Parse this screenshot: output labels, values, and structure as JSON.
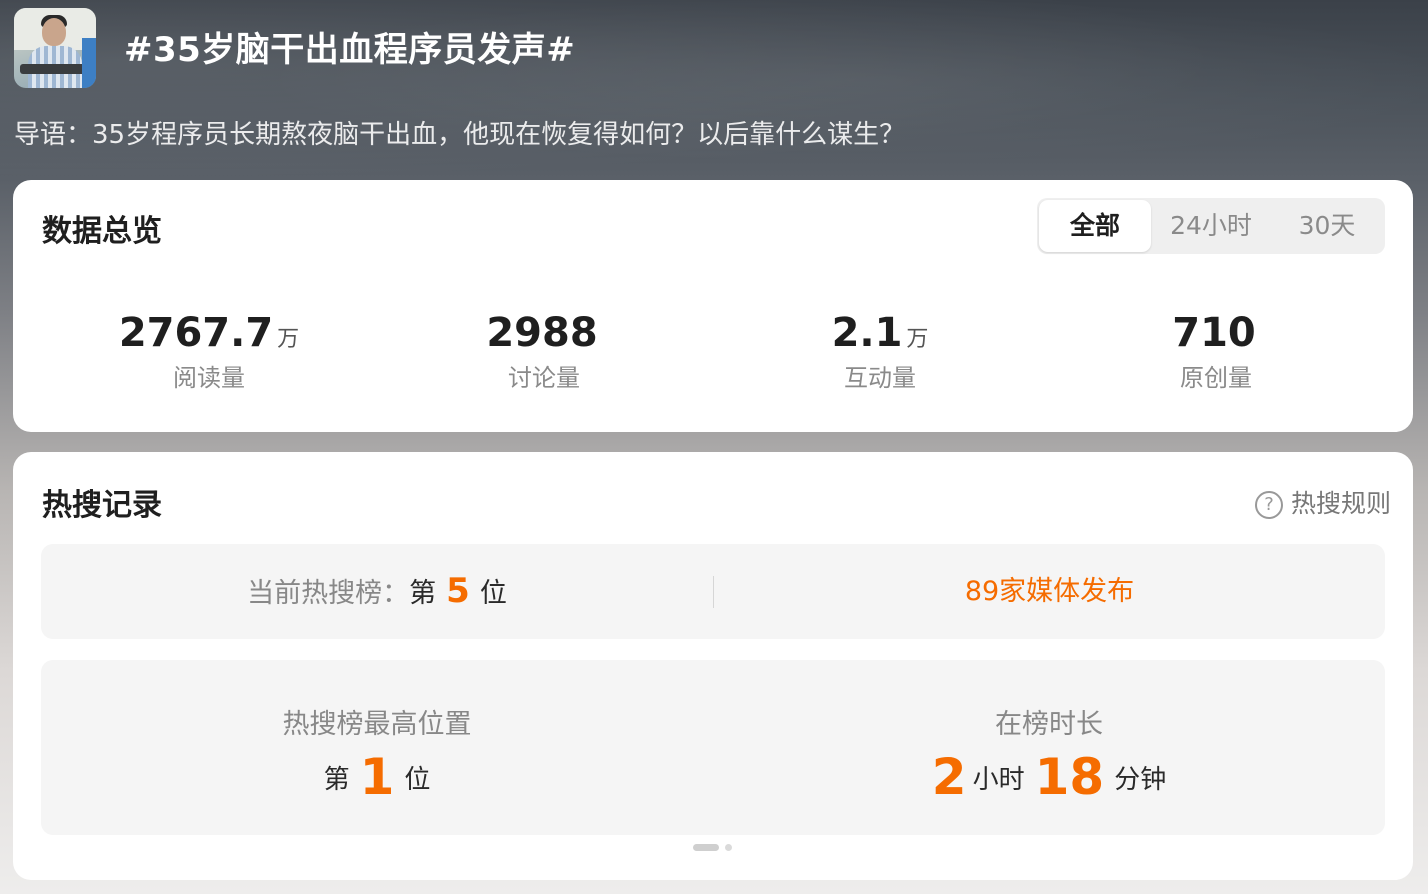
{
  "topic": {
    "title": "#35岁脑干出血程序员发声#",
    "intro": "导语：35岁程序员长期熬夜脑干出血，他现在恢复得如何？以后靠什么谋生？"
  },
  "overview": {
    "title": "数据总览",
    "tabs": [
      {
        "label": "全部",
        "active": true
      },
      {
        "label": "24小时",
        "active": false
      },
      {
        "label": "30天",
        "active": false
      }
    ],
    "stats": [
      {
        "value": "2767.7",
        "unit": "万",
        "label": "阅读量"
      },
      {
        "value": "2988",
        "unit": "",
        "label": "讨论量"
      },
      {
        "value": "2.1",
        "unit": "万",
        "label": "互动量"
      },
      {
        "value": "710",
        "unit": "",
        "label": "原创量"
      }
    ]
  },
  "hot": {
    "title": "热搜记录",
    "rules_label": "热搜规则",
    "current_label": "当前热搜榜：",
    "current_prefix": "第",
    "current_rank": "5",
    "current_suffix": "位",
    "media_text": "89家媒体发布",
    "best_label": "热搜榜最高位置",
    "best_prefix": "第",
    "best_rank": "1",
    "best_suffix": "位",
    "duration_label": "在榜时长",
    "duration_hours": "2",
    "hours_unit": "小时",
    "duration_minutes": "18",
    "minutes_unit": "分钟"
  },
  "colors": {
    "accent": "#f56c00",
    "card_bg": "#ffffff",
    "panel_bg": "#f5f5f5"
  },
  "icons": {
    "rules": "question-circle-icon"
  }
}
